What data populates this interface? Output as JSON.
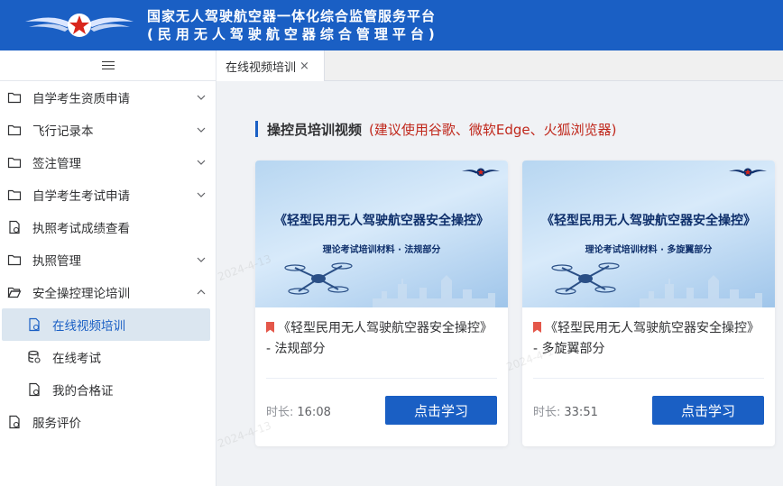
{
  "header": {
    "title": "国家无人驾驶航空器一体化综合监管服务平台",
    "subtitle": "(民用无人驾驶航空器综合管理平台)"
  },
  "sidebar": {
    "items": [
      {
        "label": "自学考生资质申请",
        "icon": "folder-icon",
        "arrow": "chevron-down-icon"
      },
      {
        "label": "飞行记录本",
        "icon": "folder-icon",
        "arrow": "chevron-down-icon"
      },
      {
        "label": "签注管理",
        "icon": "folder-icon",
        "arrow": "chevron-down-icon"
      },
      {
        "label": "自学考生考试申请",
        "icon": "folder-icon",
        "arrow": "chevron-down-icon"
      },
      {
        "label": "执照考试成绩查看",
        "icon": "document-icon"
      },
      {
        "label": "执照管理",
        "icon": "folder-icon",
        "arrow": "chevron-down-icon"
      },
      {
        "label": "安全操控理论培训",
        "icon": "folder-open-icon",
        "arrow": "chevron-up-icon"
      }
    ],
    "subitems": [
      {
        "label": "在线视频培训",
        "icon": "document-icon",
        "active": true
      },
      {
        "label": "在线考试",
        "icon": "database-icon"
      },
      {
        "label": "我的合格证",
        "icon": "document-icon"
      }
    ],
    "last_item": {
      "label": "服务评价",
      "icon": "document-icon"
    }
  },
  "tabs": [
    {
      "label": "在线视频培训",
      "close": "×"
    }
  ],
  "section": {
    "title": "操控员培训视频",
    "note": "(建议使用谷歌、微软Edge、火狐浏览器)"
  },
  "cards": [
    {
      "cover_title": "《轻型民用无人驾驶航空器安全操控》",
      "cover_subtitle": "理论考试培训材料 · 法规部分",
      "title": "《轻型民用无人驾驶航空器安全操控》 - 法规部分",
      "duration_label": "时长:",
      "duration": "16:08",
      "button": "点击学习"
    },
    {
      "cover_title": "《轻型民用无人驾驶航空器安全操控》",
      "cover_subtitle": "理论考试培训材料 · 多旋翼部分",
      "title": "《轻型民用无人驾驶航空器安全操控》 - 多旋翼部分",
      "duration_label": "时长:",
      "duration": "33:51",
      "button": "点击学习"
    }
  ],
  "watermark": "2024-4-13",
  "colors": {
    "brand": "#1a5fc4",
    "note": "#c0281c",
    "active_bg": "#dbe6f0",
    "bookmark": "#e4574a"
  }
}
